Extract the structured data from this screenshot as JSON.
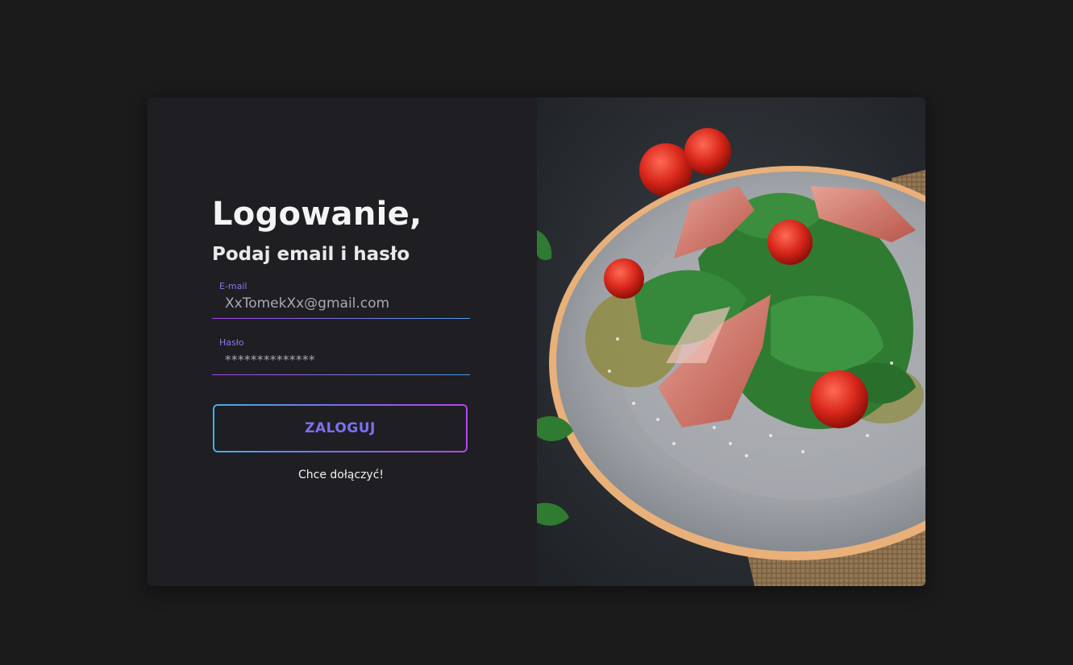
{
  "login": {
    "title": "Logowanie,",
    "subtitle": "Podaj email i hasło",
    "email": {
      "label": "E-mail",
      "value": "XxTomekXx@gmail.com"
    },
    "password": {
      "label": "Hasło",
      "value": "**************"
    },
    "submit_label": "ZALOGUJ",
    "join_link": "Chce dołączyć!"
  },
  "colors": {
    "page_background": "#1b1b1b",
    "card_background": "#1f1e23",
    "accent_purple": "#7e6ff0",
    "accent_blue": "#3fb0e9",
    "accent_magenta": "#b048ea"
  },
  "image": {
    "name": "salad-plate-photo"
  }
}
